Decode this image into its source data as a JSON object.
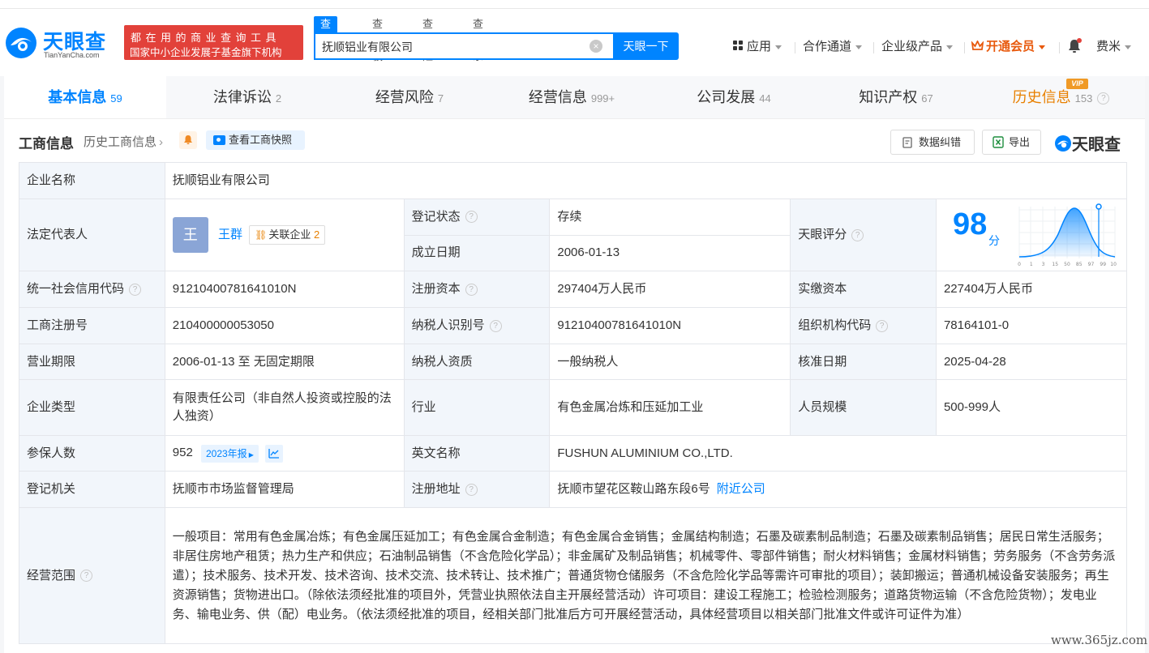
{
  "header": {
    "logo_cn": "天眼查",
    "logo_en": "TianYanCha.com",
    "slogan_line1": "都在用的商业查询工具",
    "slogan_line2": "国家中小企业发展子基金旗下机构",
    "search_tabs": [
      "查公司",
      "查老板",
      "查风险",
      "查关系"
    ],
    "search_value": "抚顺铝业有限公司",
    "search_button": "天眼一下",
    "nav": {
      "apps": "应用",
      "partners": "合作通道",
      "enterprise": "企业级产品",
      "vip": "开通会员",
      "user": "费米"
    }
  },
  "tabs": [
    {
      "label": "基本信息",
      "count": "59"
    },
    {
      "label": "法律诉讼",
      "count": "2"
    },
    {
      "label": "经营风险",
      "count": "7"
    },
    {
      "label": "经营信息",
      "count": "999+"
    },
    {
      "label": "公司发展",
      "count": "44"
    },
    {
      "label": "知识产权",
      "count": "67"
    },
    {
      "label": "历史信息",
      "count": "153"
    }
  ],
  "vip_badge": "VIP",
  "section": {
    "title": "工商信息",
    "history_link": "历史工商信息",
    "snapshot_button": "查看工商快照",
    "error_button": "数据纠错",
    "export_button": "导出",
    "brand": "天眼查"
  },
  "info": {
    "company_name_label": "企业名称",
    "company_name": "抚顺铝业有限公司",
    "legal_rep_label": "法定代表人",
    "legal_rep_avatar": "王",
    "legal_rep": "王群",
    "related_label": "关联企业",
    "related_count": "2",
    "status_label": "登记状态",
    "status": "存续",
    "founded_label": "成立日期",
    "founded": "2006-01-13",
    "score_label": "天眼评分",
    "score": "98",
    "score_unit": "分",
    "score_axis": [
      "0",
      "1",
      "3",
      "15",
      "50",
      "85",
      "97",
      "99",
      "100"
    ],
    "credit_code_label": "统一社会信用代码",
    "credit_code": "91210400781641010N",
    "reg_capital_label": "注册资本",
    "reg_capital": "297404万人民币",
    "paid_capital_label": "实缴资本",
    "paid_capital": "227404万人民币",
    "reg_no_label": "工商注册号",
    "reg_no": "210400000053050",
    "taxpayer_id_label": "纳税人识别号",
    "taxpayer_id": "91210400781641010N",
    "org_code_label": "组织机构代码",
    "org_code": "78164101-0",
    "term_label": "营业期限",
    "term": "2006-01-13 至 无固定期限",
    "taxpayer_qual_label": "纳税人资质",
    "taxpayer_qual": "一般纳税人",
    "approval_date_label": "核准日期",
    "approval_date": "2025-04-28",
    "type_label": "企业类型",
    "type": "有限责任公司（非自然人投资或控股的法人独资）",
    "industry_label": "行业",
    "industry": "有色金属冶炼和压延加工业",
    "staff_size_label": "人员规模",
    "staff_size": "500-999人",
    "insured_label": "参保人数",
    "insured": "952",
    "report_button": "2023年报",
    "en_name_label": "英文名称",
    "en_name": "FUSHUN ALUMINIUM CO.,LTD.",
    "authority_label": "登记机关",
    "authority": "抚顺市市场监督管理局",
    "address_label": "注册地址",
    "address": "抚顺市望花区鞍山路东段6号",
    "nearby_link": "附近公司",
    "scope_label": "经营范围",
    "scope": "一般项目：常用有色金属冶炼；有色金属压延加工；有色金属合金制造；有色金属合金销售；金属结构制造；石墨及碳素制品制造；石墨及碳素制品销售；居民日常生活服务；非居住房地产租赁；热力生产和供应；石油制品销售（不含危险化学品）；非金属矿及制品销售；机械零件、零部件销售；耐火材料销售；金属材料销售；劳务服务（不含劳务派遣）；技术服务、技术开发、技术咨询、技术交流、技术转让、技术推广；普通货物仓储服务（不含危险化学品等需许可审批的项目）；装卸搬运；普通机械设备安装服务；再生资源销售；货物进出口。（除依法须经批准的项目外，凭营业执照依法自主开展经营活动）许可项目：建设工程施工；检验检测服务；道路货物运输（不含危险货物）；发电业务、输电业务、供（配）电业务。（依法须经批准的项目，经相关部门批准后方可开展经营活动，具体经营项目以相关部门批准文件或许可证件为准）"
  },
  "watermark": "www.365jz.com",
  "colors": {
    "accent": "#0084ff",
    "slogan_bg": "#e2413a",
    "status_green": "#21a05c",
    "history_orange": "#e88000"
  }
}
